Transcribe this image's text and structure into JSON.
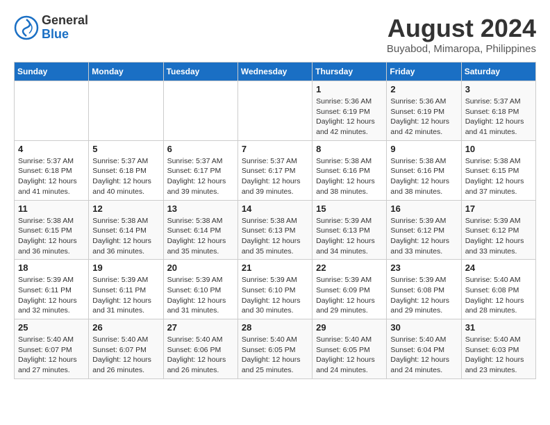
{
  "header": {
    "logo_line1": "General",
    "logo_line2": "Blue",
    "title": "August 2024",
    "subtitle": "Buyabod, Mimaropa, Philippines"
  },
  "days_of_week": [
    "Sunday",
    "Monday",
    "Tuesday",
    "Wednesday",
    "Thursday",
    "Friday",
    "Saturday"
  ],
  "weeks": [
    [
      {
        "day": "",
        "info": ""
      },
      {
        "day": "",
        "info": ""
      },
      {
        "day": "",
        "info": ""
      },
      {
        "day": "",
        "info": ""
      },
      {
        "day": "1",
        "info": "Sunrise: 5:36 AM\nSunset: 6:19 PM\nDaylight: 12 hours\nand 42 minutes."
      },
      {
        "day": "2",
        "info": "Sunrise: 5:36 AM\nSunset: 6:19 PM\nDaylight: 12 hours\nand 42 minutes."
      },
      {
        "day": "3",
        "info": "Sunrise: 5:37 AM\nSunset: 6:18 PM\nDaylight: 12 hours\nand 41 minutes."
      }
    ],
    [
      {
        "day": "4",
        "info": "Sunrise: 5:37 AM\nSunset: 6:18 PM\nDaylight: 12 hours\nand 41 minutes."
      },
      {
        "day": "5",
        "info": "Sunrise: 5:37 AM\nSunset: 6:18 PM\nDaylight: 12 hours\nand 40 minutes."
      },
      {
        "day": "6",
        "info": "Sunrise: 5:37 AM\nSunset: 6:17 PM\nDaylight: 12 hours\nand 39 minutes."
      },
      {
        "day": "7",
        "info": "Sunrise: 5:37 AM\nSunset: 6:17 PM\nDaylight: 12 hours\nand 39 minutes."
      },
      {
        "day": "8",
        "info": "Sunrise: 5:38 AM\nSunset: 6:16 PM\nDaylight: 12 hours\nand 38 minutes."
      },
      {
        "day": "9",
        "info": "Sunrise: 5:38 AM\nSunset: 6:16 PM\nDaylight: 12 hours\nand 38 minutes."
      },
      {
        "day": "10",
        "info": "Sunrise: 5:38 AM\nSunset: 6:15 PM\nDaylight: 12 hours\nand 37 minutes."
      }
    ],
    [
      {
        "day": "11",
        "info": "Sunrise: 5:38 AM\nSunset: 6:15 PM\nDaylight: 12 hours\nand 36 minutes."
      },
      {
        "day": "12",
        "info": "Sunrise: 5:38 AM\nSunset: 6:14 PM\nDaylight: 12 hours\nand 36 minutes."
      },
      {
        "day": "13",
        "info": "Sunrise: 5:38 AM\nSunset: 6:14 PM\nDaylight: 12 hours\nand 35 minutes."
      },
      {
        "day": "14",
        "info": "Sunrise: 5:38 AM\nSunset: 6:13 PM\nDaylight: 12 hours\nand 35 minutes."
      },
      {
        "day": "15",
        "info": "Sunrise: 5:39 AM\nSunset: 6:13 PM\nDaylight: 12 hours\nand 34 minutes."
      },
      {
        "day": "16",
        "info": "Sunrise: 5:39 AM\nSunset: 6:12 PM\nDaylight: 12 hours\nand 33 minutes."
      },
      {
        "day": "17",
        "info": "Sunrise: 5:39 AM\nSunset: 6:12 PM\nDaylight: 12 hours\nand 33 minutes."
      }
    ],
    [
      {
        "day": "18",
        "info": "Sunrise: 5:39 AM\nSunset: 6:11 PM\nDaylight: 12 hours\nand 32 minutes."
      },
      {
        "day": "19",
        "info": "Sunrise: 5:39 AM\nSunset: 6:11 PM\nDaylight: 12 hours\nand 31 minutes."
      },
      {
        "day": "20",
        "info": "Sunrise: 5:39 AM\nSunset: 6:10 PM\nDaylight: 12 hours\nand 31 minutes."
      },
      {
        "day": "21",
        "info": "Sunrise: 5:39 AM\nSunset: 6:10 PM\nDaylight: 12 hours\nand 30 minutes."
      },
      {
        "day": "22",
        "info": "Sunrise: 5:39 AM\nSunset: 6:09 PM\nDaylight: 12 hours\nand 29 minutes."
      },
      {
        "day": "23",
        "info": "Sunrise: 5:39 AM\nSunset: 6:08 PM\nDaylight: 12 hours\nand 29 minutes."
      },
      {
        "day": "24",
        "info": "Sunrise: 5:40 AM\nSunset: 6:08 PM\nDaylight: 12 hours\nand 28 minutes."
      }
    ],
    [
      {
        "day": "25",
        "info": "Sunrise: 5:40 AM\nSunset: 6:07 PM\nDaylight: 12 hours\nand 27 minutes."
      },
      {
        "day": "26",
        "info": "Sunrise: 5:40 AM\nSunset: 6:07 PM\nDaylight: 12 hours\nand 26 minutes."
      },
      {
        "day": "27",
        "info": "Sunrise: 5:40 AM\nSunset: 6:06 PM\nDaylight: 12 hours\nand 26 minutes."
      },
      {
        "day": "28",
        "info": "Sunrise: 5:40 AM\nSunset: 6:05 PM\nDaylight: 12 hours\nand 25 minutes."
      },
      {
        "day": "29",
        "info": "Sunrise: 5:40 AM\nSunset: 6:05 PM\nDaylight: 12 hours\nand 24 minutes."
      },
      {
        "day": "30",
        "info": "Sunrise: 5:40 AM\nSunset: 6:04 PM\nDaylight: 12 hours\nand 24 minutes."
      },
      {
        "day": "31",
        "info": "Sunrise: 5:40 AM\nSunset: 6:03 PM\nDaylight: 12 hours\nand 23 minutes."
      }
    ]
  ]
}
